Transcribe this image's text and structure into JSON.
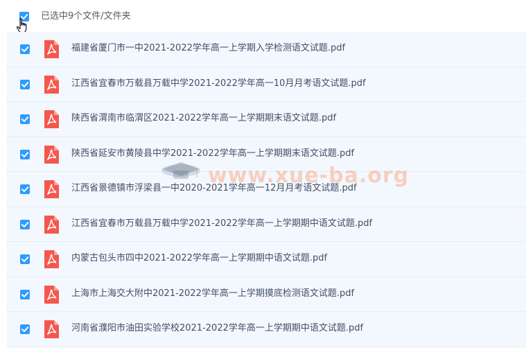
{
  "header": {
    "summary_text": "已选中9个文件/文件夹",
    "select_all_checked": true
  },
  "colors": {
    "checkbox": "#2d9bff",
    "pdf_icon": "#f5574c",
    "row_background": "#f3f8fe",
    "file_name_text": "#424e67"
  },
  "files": [
    {
      "name": "福建省厦门市一中2021-2022学年高一上学期入学检测语文试题.pdf",
      "icon": "pdf-icon",
      "checked": true
    },
    {
      "name": "江西省宜春市万载县万载中学2021-2022学年高一10月月考语文试题.pdf",
      "icon": "pdf-icon",
      "checked": true
    },
    {
      "name": "陕西省渭南市临渭区2021-2022学年高一上学期期末语文试题.pdf",
      "icon": "pdf-icon",
      "checked": true
    },
    {
      "name": "陕西省延安市黄陵县中学2021-2022学年高一上学期期末语文试题.pdf",
      "icon": "pdf-icon",
      "checked": true
    },
    {
      "name": "江西省景德镇市浮梁县一中2020-2021学年高一12月月考语文试题.pdf",
      "icon": "pdf-icon",
      "checked": true
    },
    {
      "name": "江西省宜春市万载县万载中学2021-2022学年高一上学期期中语文试题.pdf",
      "icon": "pdf-icon",
      "checked": true
    },
    {
      "name": "内蒙古包头市四中2021-2022学年高一上学期期中语文试题.pdf",
      "icon": "pdf-icon",
      "checked": true
    },
    {
      "name": "上海市上海交大附中2021-2022学年高一上学期摸底检测语文试题.pdf",
      "icon": "pdf-icon",
      "checked": true
    },
    {
      "name": "河南省濮阳市油田实验学校2021-2022学年高一上学期期中语文试题.pdf",
      "icon": "pdf-icon",
      "checked": true
    }
  ],
  "watermark": {
    "text": "www.xue-ba.org"
  }
}
